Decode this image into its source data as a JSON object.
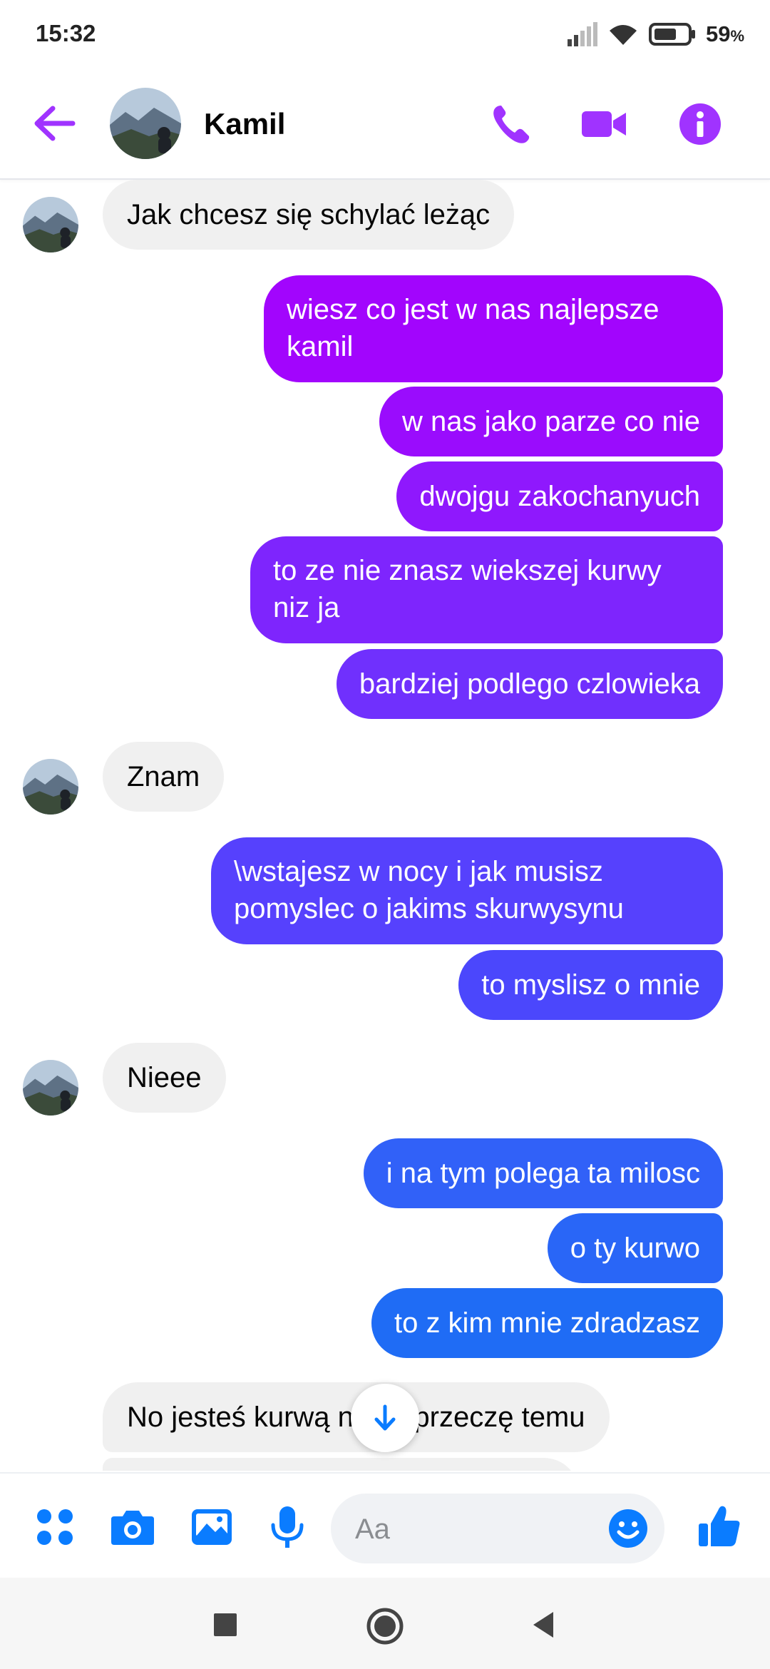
{
  "status_bar": {
    "time": "15:32",
    "battery_percent": "59",
    "battery_unit": "%"
  },
  "header": {
    "contact_name": "Kamil"
  },
  "colors": {
    "accent": "#a033ff",
    "gradient_top": "#a100ff",
    "gradient_mid": "#6b3cff",
    "gradient_bottom": "#1f6cf5",
    "incoming_bg": "#f0f0f0",
    "composer_icons": "#0a7cff"
  },
  "messages": [
    {
      "direction": "incoming",
      "text": "Jak chcesz się schylać leżąc",
      "avatar": true
    },
    {
      "direction": "outgoing",
      "text": "wiesz co jest w nas najlepsze kamil"
    },
    {
      "direction": "outgoing",
      "text": "w nas jako parze co nie"
    },
    {
      "direction": "outgoing",
      "text": "dwojgu zakochanyuch"
    },
    {
      "direction": "outgoing",
      "text": "to ze nie znasz wiekszej kurwy niz ja"
    },
    {
      "direction": "outgoing",
      "text": "bardziej podlego czlowieka"
    },
    {
      "direction": "incoming",
      "text": "Znam",
      "avatar": true
    },
    {
      "direction": "outgoing",
      "text": "\\wstajesz w nocy i jak musisz pomyslec o jakims skurwysynu"
    },
    {
      "direction": "outgoing",
      "text": "to myslisz o mnie"
    },
    {
      "direction": "incoming",
      "text": "Nieee",
      "avatar": true
    },
    {
      "direction": "outgoing",
      "text": "i na tym polega ta milosc"
    },
    {
      "direction": "outgoing",
      "text": "o ty kurwo"
    },
    {
      "direction": "outgoing",
      "text": "to z kim mnie zdradzasz"
    },
    {
      "direction": "incoming",
      "text": "No jesteś kurwą nie zaprzeczę temu",
      "avatar": false
    }
  ],
  "composer": {
    "placeholder": "Aa",
    "icons": [
      "apps-icon",
      "camera-icon",
      "gallery-icon",
      "microphone-icon",
      "emoji-icon",
      "thumbs-up-icon"
    ]
  },
  "nav_bar": {
    "icons": [
      "recents-icon",
      "home-icon",
      "back-icon"
    ]
  }
}
